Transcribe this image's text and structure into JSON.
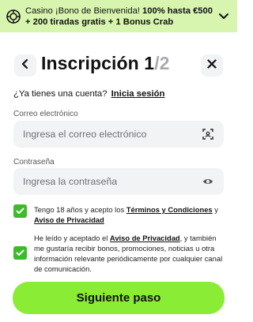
{
  "banner": {
    "icon": "chip-icon",
    "text_plain": "Casino ¡Bono de Bienvenida! ",
    "text_bold": "100% hasta €500 + 200 tiradas gratis + 1 Bonus Crab",
    "bg_color": "#d8f5b0"
  },
  "header": {
    "title_main": "Inscripción 1",
    "title_muted": "/2"
  },
  "login": {
    "prompt": "¿Ya tienes una cuenta?",
    "link": "Inicia sesión"
  },
  "email": {
    "label": "Correo electrónico",
    "placeholder": "Ingresa el correo electrónico"
  },
  "password": {
    "label": "Contraseña",
    "placeholder": "Ingresa la contraseña"
  },
  "consent_age": {
    "checked": true,
    "text_before": "Tengo 18 años y acepto los ",
    "link_terms": "Términos y Condiciones",
    "text_mid": " y ",
    "link_privacy": "Aviso de Privacidad"
  },
  "consent_marketing": {
    "checked": true,
    "text_before": "He leído y aceptado el ",
    "link_privacy": "Aviso de Privacidad",
    "text_after": ", y también me gustaría recibir bonos, promociones, noticias u otra información relevante periódicamente por cualquier canal de comunicación."
  },
  "cta": {
    "label": "Siguiente paso",
    "color": "#8aec35"
  },
  "colors": {
    "accent_green": "#3dbb2a",
    "field_bg": "#f2f3f5"
  }
}
